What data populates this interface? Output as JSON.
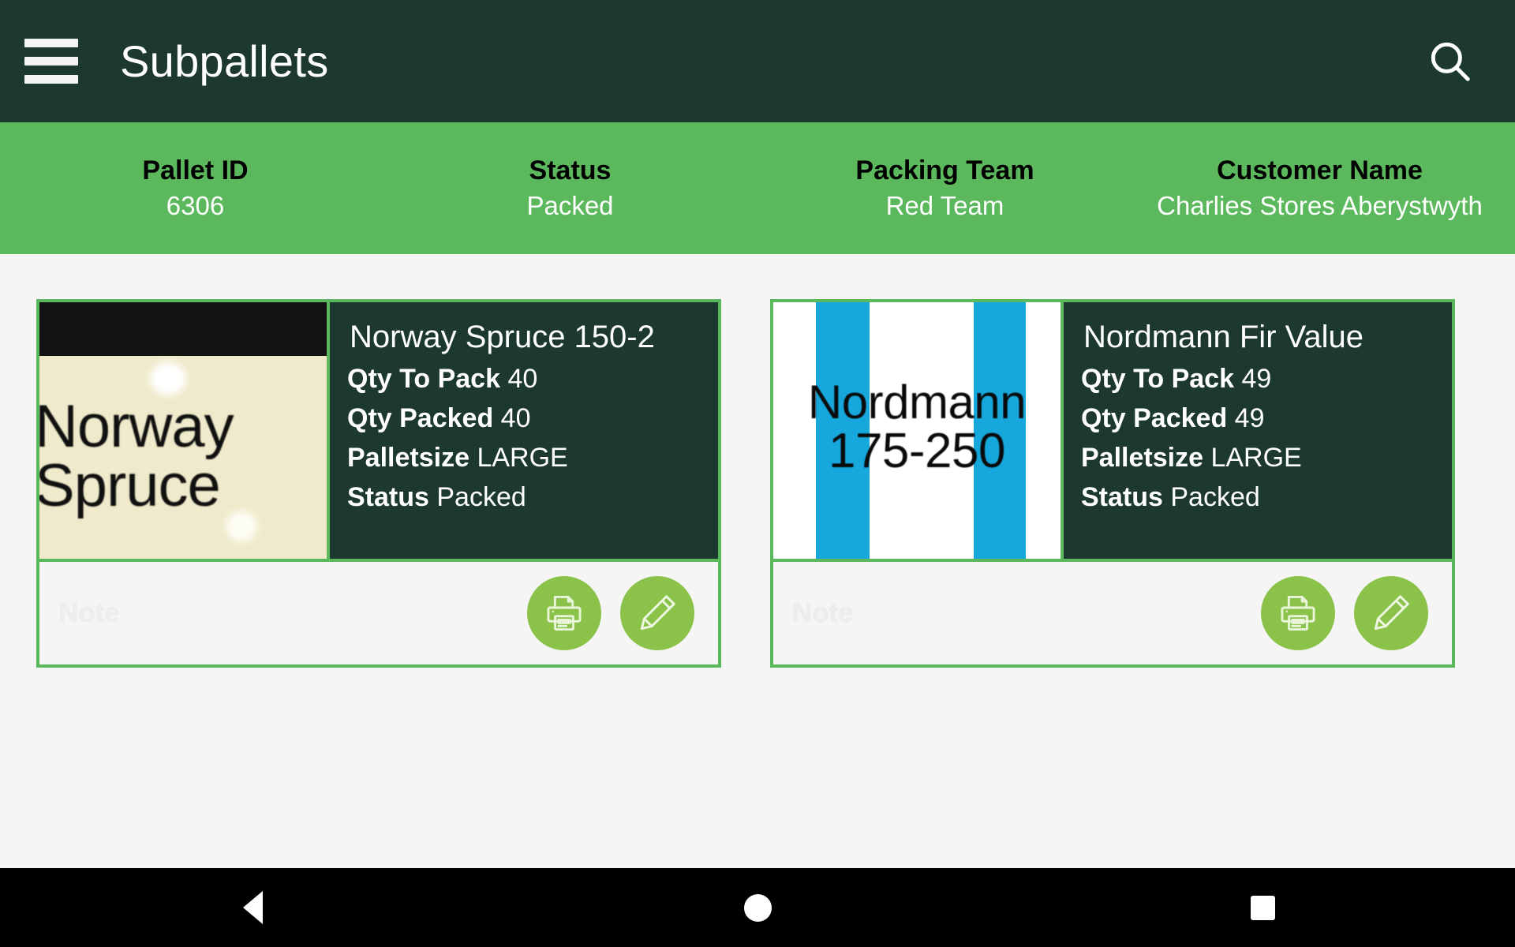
{
  "appbar": {
    "title": "Subpallets",
    "menu_icon": "hamburger-menu-icon",
    "search_icon": "search-icon"
  },
  "summary": {
    "columns": [
      {
        "label": "Pallet ID",
        "value": "6306"
      },
      {
        "label": "Status",
        "value": "Packed"
      },
      {
        "label": "Packing Team",
        "value": "Red Team"
      },
      {
        "label": "Customer Name",
        "value": "Charlies Stores Aberystwyth"
      }
    ]
  },
  "cards": [
    {
      "title": "Norway Spruce 150-2",
      "thumbnail_text_line1": "Norway",
      "thumbnail_text_line2": "Spruce",
      "rows": [
        {
          "key": "Qty To Pack",
          "value": "40"
        },
        {
          "key": "Qty Packed",
          "value": "40"
        },
        {
          "key": "Palletsize",
          "value": "LARGE"
        },
        {
          "key": "Status",
          "value": "Packed"
        }
      ],
      "note_placeholder": "Note",
      "print_icon": "printer-icon",
      "edit_icon": "pencil-icon"
    },
    {
      "title": "Nordmann Fir Value",
      "thumbnail_text_line1": "Nordmann",
      "thumbnail_text_line2": "175-250",
      "rows": [
        {
          "key": "Qty To Pack",
          "value": "49"
        },
        {
          "key": "Qty Packed",
          "value": "49"
        },
        {
          "key": "Palletsize",
          "value": "LARGE"
        },
        {
          "key": "Status",
          "value": "Packed"
        }
      ],
      "note_placeholder": "Note",
      "print_icon": "printer-icon",
      "edit_icon": "pencil-icon"
    }
  ],
  "navbar": {
    "back": "back-triangle-icon",
    "home": "home-circle-icon",
    "recents": "recents-square-icon"
  },
  "colors": {
    "appbar_bg": "#1d382f",
    "summary_bg": "#5cb85c",
    "card_border": "#5cb85c",
    "card_body_bg": "#1d382f",
    "fab_bg": "#8bc34a",
    "page_bg": "#f4f5f4"
  }
}
